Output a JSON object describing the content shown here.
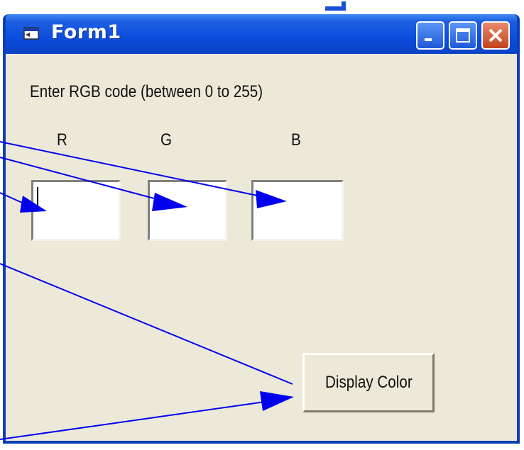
{
  "window": {
    "title": "Form1",
    "buttons": [
      "minimize",
      "maximize",
      "close"
    ]
  },
  "form": {
    "prompt": "Enter RGB code (between 0 to 255)",
    "labels": {
      "r": "R",
      "g": "G",
      "b": "B"
    },
    "inputs": {
      "r": "",
      "g": "",
      "b": ""
    },
    "button_label": "Display Color"
  },
  "annotations": {
    "arrow_color": "#0000ee"
  },
  "colors": {
    "titlebar": "#0b4ddc",
    "window_bg": "#ece9d8",
    "close_button": "#c2431c"
  }
}
